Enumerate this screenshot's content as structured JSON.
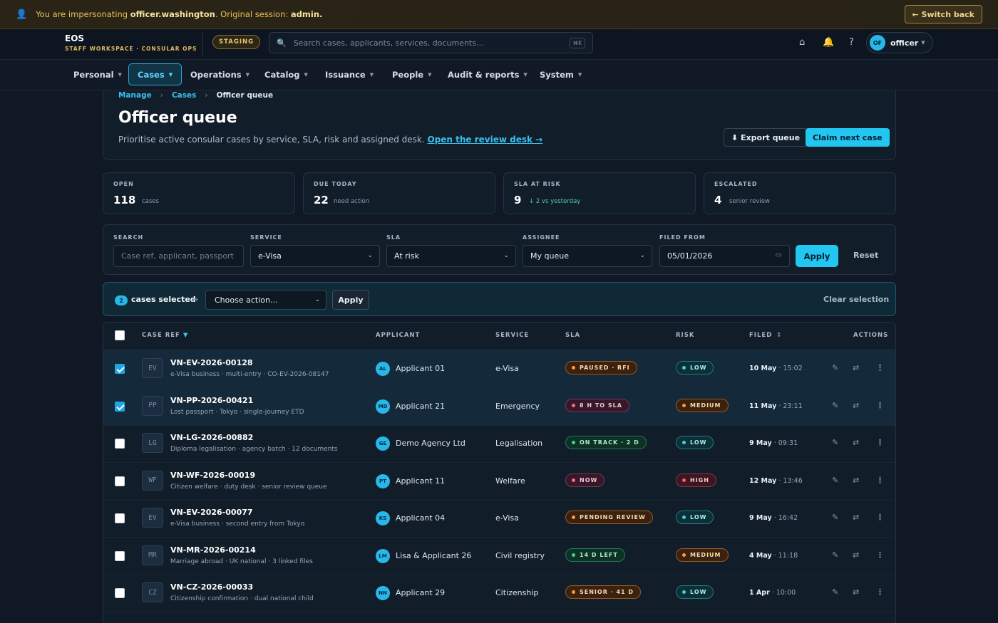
{
  "impersonation": {
    "prefix": "You are impersonating ",
    "user": "officer.washington",
    "middle": ". Original session: ",
    "original": "admin.",
    "switch_back": "← Switch back"
  },
  "topbar": {
    "app_name": "EOS",
    "app_sub": "STAFF WORKSPACE · CONSULAR OPS",
    "env_badge": "STAGING",
    "search_placeholder": "Search cases, applicants, services, documents…",
    "search_shortcut": "⌘K",
    "user_initials": "OF",
    "user_name": "officer"
  },
  "nav": [
    {
      "label": "Personal"
    },
    {
      "label": "Cases",
      "active": true
    },
    {
      "label": "Operations"
    },
    {
      "label": "Catalog"
    },
    {
      "label": "Issuance"
    },
    {
      "label": "People"
    },
    {
      "label": "Audit & reports"
    },
    {
      "label": "System"
    }
  ],
  "header": {
    "breadcrumb": [
      "Manage",
      "Cases",
      "Officer queue"
    ],
    "title": "Officer queue",
    "description": "Prioritise active consular cases by service, SLA, risk and assigned desk.",
    "review_link": "Open the review desk →",
    "export_label": "⬇ Export queue",
    "claim_label": "Claim next case"
  },
  "stats": [
    {
      "label": "OPEN",
      "value": "118",
      "note": "cases"
    },
    {
      "label": "DUE TODAY",
      "value": "22",
      "note": "need action"
    },
    {
      "label": "SLA AT RISK",
      "value": "9",
      "note": "↓ 2 vs yesterday"
    },
    {
      "label": "ESCALATED",
      "value": "4",
      "note": "senior review"
    }
  ],
  "filters": {
    "search_label": "SEARCH",
    "search_placeholder": "Case ref, applicant, passport",
    "service_label": "SERVICE",
    "service_value": "e-Visa",
    "sla_label": "SLA",
    "sla_value": "At risk",
    "assignee_label": "ASSIGNEE",
    "assignee_value": "My queue",
    "filed_label": "FILED FROM",
    "filed_value": "05/01/2026",
    "apply_label": "Apply",
    "reset_label": "Reset"
  },
  "bulk": {
    "count": "2",
    "selected_label": "cases selected",
    "action_placeholder": "Choose action…",
    "apply_label": "Apply",
    "clear_label": "Clear selection"
  },
  "table": {
    "columns": {
      "case_ref": "CASE REF",
      "applicant": "APPLICANT",
      "service": "SERVICE",
      "sla": "SLA",
      "risk": "RISK",
      "filed": "FILED",
      "actions": "ACTIONS"
    },
    "rows": [
      {
        "selected": true,
        "tile": "EV",
        "ref": "VN-EV-2026-00128",
        "desc": "e-Visa business · multi-entry · CO-EV-2026-08147",
        "initials": "AL",
        "applicant": "Applicant 01",
        "service": "e-Visa",
        "sla": "PAUSED · RFI",
        "sla_tone": "orange",
        "risk": "LOW",
        "risk_tone": "teal",
        "filed_date": "10 May",
        "filed_time": "· 15:02"
      },
      {
        "selected": true,
        "tile": "PP",
        "ref": "VN-PP-2026-00421",
        "desc": "Lost passport · Tokyo · single-journey ETD",
        "initials": "MD",
        "applicant": "Applicant 21",
        "service": "Emergency",
        "sla": "8 H TO SLA",
        "sla_tone": "red",
        "risk": "MEDIUM",
        "risk_tone": "orange",
        "filed_date": "11 May",
        "filed_time": "· 23:11"
      },
      {
        "selected": false,
        "tile": "LG",
        "ref": "VN-LG-2026-00882",
        "desc": "Diploma legalisation · agency batch · 12 documents",
        "initials": "GE",
        "applicant": "Demo Agency Ltd",
        "service": "Legalisation",
        "sla": "ON TRACK · 2 D",
        "sla_tone": "green",
        "risk": "LOW",
        "risk_tone": "teal",
        "filed_date": "9 May",
        "filed_time": "· 09:31"
      },
      {
        "selected": false,
        "tile": "WF",
        "ref": "VN-WF-2026-00019",
        "desc": "Citizen welfare · duty desk · senior review queue",
        "initials": "PT",
        "applicant": "Applicant 11",
        "service": "Welfare",
        "sla": "NOW",
        "sla_tone": "red",
        "risk": "HIGH",
        "risk_tone": "rred",
        "filed_date": "12 May",
        "filed_time": "· 13:46"
      },
      {
        "selected": false,
        "tile": "EV",
        "ref": "VN-EV-2026-00077",
        "desc": "e-Visa business · second entry from Tokyo",
        "initials": "KS",
        "applicant": "Applicant 04",
        "service": "e-Visa",
        "sla": "PENDING REVIEW",
        "sla_tone": "orange",
        "risk": "LOW",
        "risk_tone": "teal",
        "filed_date": "9 May",
        "filed_time": "· 16:42"
      },
      {
        "selected": false,
        "tile": "MR",
        "ref": "VN-MR-2026-00214",
        "desc": "Marriage abroad · UK national · 3 linked files",
        "initials": "LM",
        "applicant": "Lisa & Applicant 26",
        "service": "Civil registry",
        "sla": "14 D LEFT",
        "sla_tone": "green",
        "risk": "MEDIUM",
        "risk_tone": "orange",
        "filed_date": "4 May",
        "filed_time": "· 11:18"
      },
      {
        "selected": false,
        "tile": "CZ",
        "ref": "VN-CZ-2026-00033",
        "desc": "Citizenship confirmation · dual national child",
        "initials": "NN",
        "applicant": "Applicant 29",
        "service": "Citizenship",
        "sla": "SENIOR · 41 D",
        "sla_tone": "orange",
        "risk": "LOW",
        "risk_tone": "teal",
        "filed_date": "1 Apr",
        "filed_time": "· 10:00"
      }
    ]
  }
}
